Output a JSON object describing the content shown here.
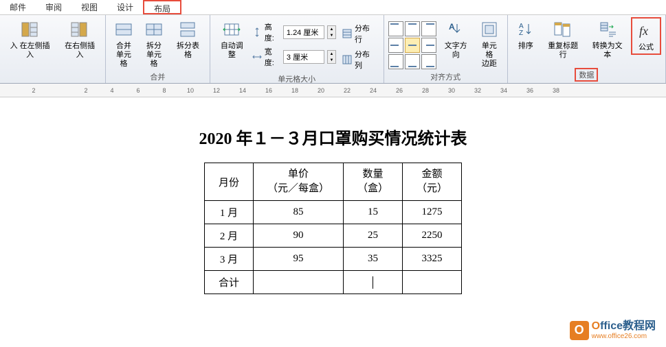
{
  "tabs": {
    "mail": "邮件",
    "review": "审阅",
    "view": "视图",
    "design": "设计",
    "layout": "布局"
  },
  "ribbon": {
    "insert_left": "入 在左侧插入",
    "insert_right": "在右侧插入",
    "merge_cells": "合并\n单元格",
    "split_cells": "拆分\n单元格",
    "split_table": "拆分表格",
    "group_merge": "合并",
    "auto_adjust": "自动调整",
    "height_label": "高度:",
    "height_value": "1.24 厘米",
    "width_label": "宽度:",
    "width_value": "3 厘米",
    "distribute_rows": "分布行",
    "distribute_cols": "分布列",
    "group_cellsize": "单元格大小",
    "text_direction": "文字方向",
    "cell_margins": "单元格\n边距",
    "group_alignment": "对齐方式",
    "sort": "排序",
    "repeat_header": "重复标题行",
    "convert_text": "转换为文本",
    "formula": "公式",
    "group_data": "数据"
  },
  "ruler": [
    "2",
    "",
    "2",
    "4",
    "6",
    "8",
    "10",
    "12",
    "14",
    "16",
    "18",
    "20",
    "22",
    "24",
    "26",
    "28",
    "30",
    "32",
    "34",
    "36",
    "38"
  ],
  "doc": {
    "title": "2020 年１－３月口罩购买情况统计表",
    "headers": {
      "month": "月份",
      "price": "单价",
      "price_unit": "（元／每盒）",
      "qty": "数量",
      "qty_unit": "（盒）",
      "amount": "金额",
      "amount_unit": "（元）"
    },
    "rows": [
      {
        "month": "1 月",
        "price": "85",
        "qty": "15",
        "amount": "1275"
      },
      {
        "month": "2 月",
        "price": "90",
        "qty": "25",
        "amount": "2250"
      },
      {
        "month": "3 月",
        "price": "95",
        "qty": "35",
        "amount": "3325"
      }
    ],
    "total_label": "合计"
  },
  "watermark": {
    "brand1": "O",
    "brand2": "ffice教程网",
    "url": "www.office26.com"
  },
  "chart_data": {
    "type": "table",
    "title": "2020 年１－３月口罩购买情况统计表",
    "columns": [
      "月份",
      "单价（元／每盒）",
      "数量（盒）",
      "金额（元）"
    ],
    "rows": [
      [
        "1 月",
        85,
        15,
        1275
      ],
      [
        "2 月",
        90,
        25,
        2250
      ],
      [
        "3 月",
        95,
        35,
        3325
      ],
      [
        "合计",
        null,
        null,
        null
      ]
    ]
  }
}
